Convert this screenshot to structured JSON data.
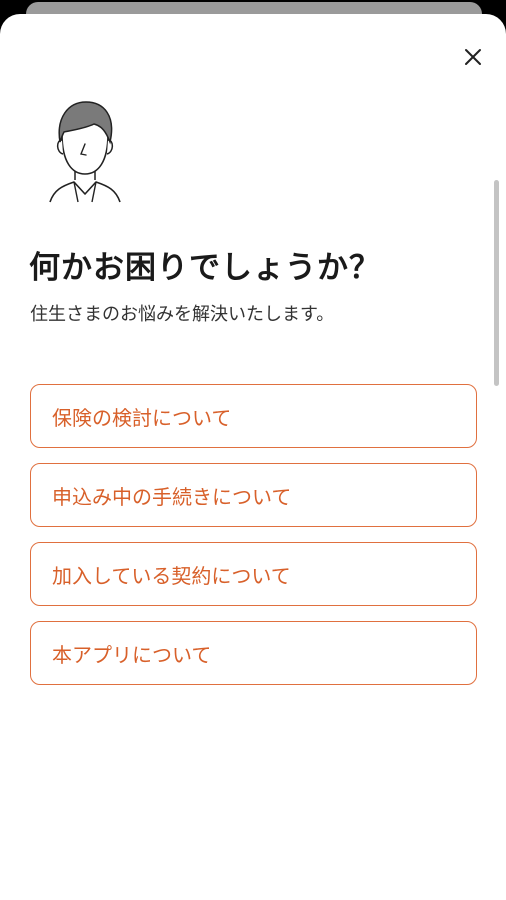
{
  "dialog": {
    "title": "何かお困りでしょうか？",
    "subtitle": "住生さまのお悩みを解決いたします。",
    "close_icon": "close-icon",
    "avatar_icon": "person-avatar-icon"
  },
  "options": [
    {
      "label": "保険の検討について"
    },
    {
      "label": "申込み中の手続きについて"
    },
    {
      "label": "加入している契約について"
    },
    {
      "label": "本アプリについて"
    }
  ],
  "colors": {
    "accent": "#e0703f",
    "accent_text": "#d8602a",
    "title": "#1a1a1a",
    "background": "#ffffff",
    "backdrop": "#000000"
  }
}
